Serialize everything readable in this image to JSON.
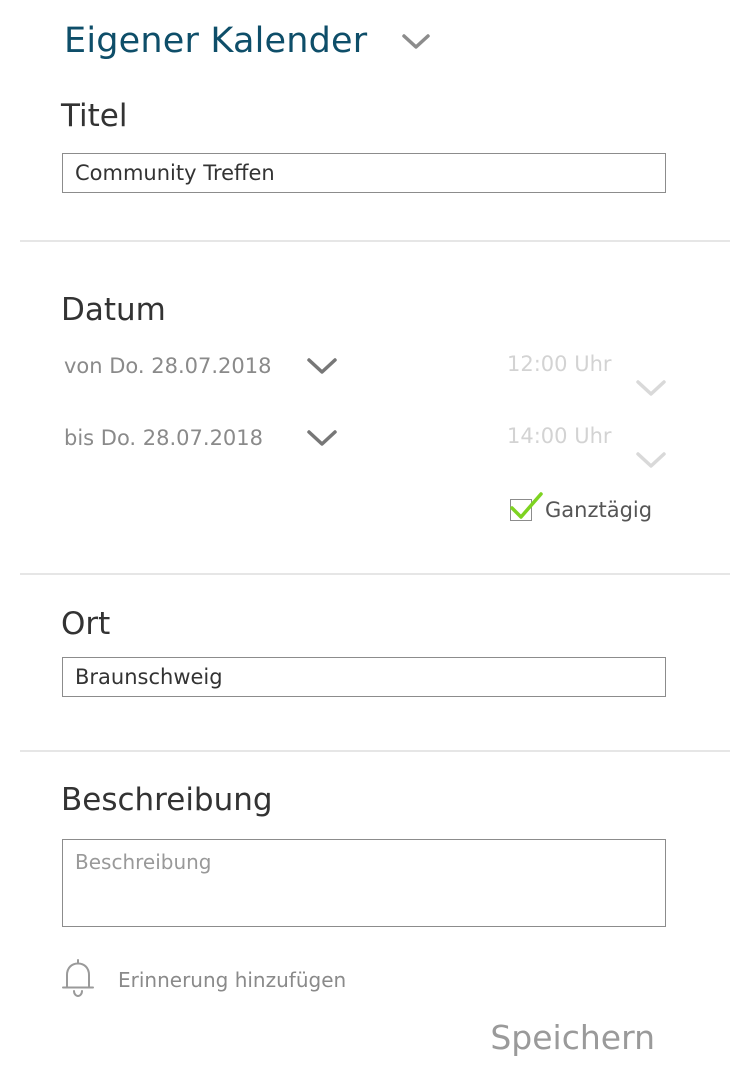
{
  "header": {
    "calendar_name": "Eigener Kalender",
    "chevron_icon": "chevron-down-icon"
  },
  "title_section": {
    "label": "Titel",
    "value": "Community Treffen"
  },
  "date_section": {
    "label": "Datum",
    "from_date": "von Do. 28.07.2018",
    "from_time": "12:00 Uhr",
    "to_date": "bis Do. 28.07.2018",
    "to_time": "14:00 Uhr",
    "all_day_label": "Ganztägig",
    "all_day_checked": true
  },
  "location_section": {
    "label": "Ort",
    "value": "Braunschweig"
  },
  "description_section": {
    "label": "Beschreibung",
    "value": "",
    "placeholder": "Beschreibung"
  },
  "reminder": {
    "label": "Erinnerung hinzufügen",
    "icon": "bell-icon"
  },
  "save_label": "Speichern",
  "colors": {
    "heading_accent": "#0e4e69",
    "check_green": "#7ed321",
    "text_dark": "#333333",
    "text_muted": "#8a8a8a",
    "text_disabled": "#d3d3d3",
    "divider": "#e6e6e6"
  }
}
